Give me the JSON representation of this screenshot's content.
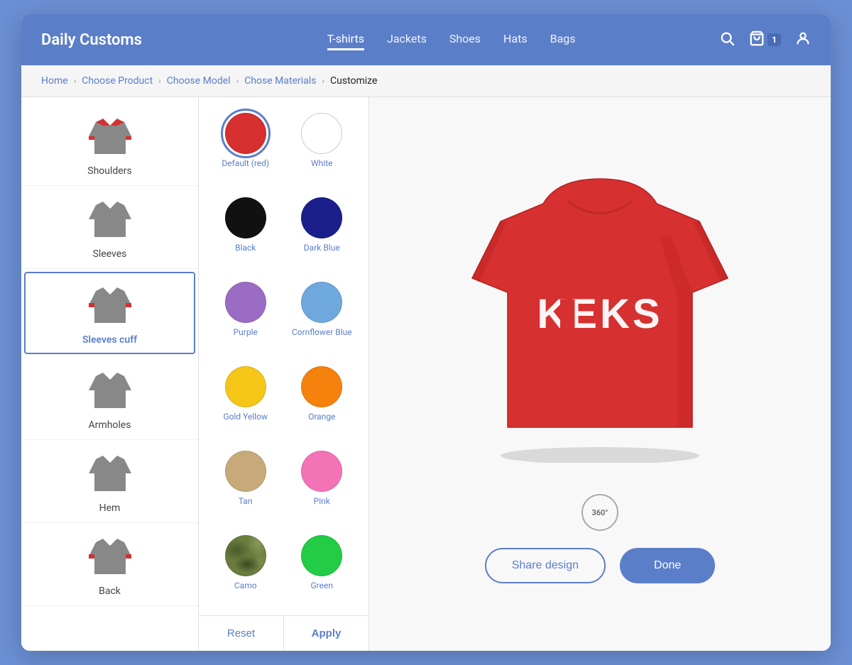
{
  "app": {
    "title": "Daily Customs",
    "star_icon": "⭐"
  },
  "header": {
    "nav": [
      {
        "label": "T-shirts",
        "active": true
      },
      {
        "label": "Jackets",
        "active": false
      },
      {
        "label": "Shoes",
        "active": false
      },
      {
        "label": "Hats",
        "active": false
      },
      {
        "label": "Bags",
        "active": false
      }
    ],
    "cart_count": "1"
  },
  "breadcrumb": {
    "items": [
      {
        "label": "Home",
        "active": false
      },
      {
        "label": "Choose Product",
        "active": false
      },
      {
        "label": "Choose Model",
        "active": false
      },
      {
        "label": "Chose Materials",
        "active": false
      },
      {
        "label": "Customize",
        "active": true
      }
    ]
  },
  "parts": [
    {
      "label": "Shoulders",
      "selected": false,
      "body_color": "#888",
      "accent_color": "#d63030"
    },
    {
      "label": "Sleeves",
      "selected": false,
      "body_color": "#888",
      "accent_color": "#888"
    },
    {
      "label": "Sleeves cuff",
      "selected": true,
      "body_color": "#888",
      "accent_color": "#d63030"
    },
    {
      "label": "Armholes",
      "selected": false,
      "body_color": "#888",
      "accent_color": "#888"
    },
    {
      "label": "Hem",
      "selected": false,
      "body_color": "#888",
      "accent_color": "#888"
    },
    {
      "label": "Back",
      "selected": false,
      "body_color": "#888",
      "accent_color": "#d63030"
    }
  ],
  "colors": [
    {
      "label": "Default (red)",
      "value": "#d63030",
      "selected": true
    },
    {
      "label": "White",
      "value": "#ffffff",
      "border": true
    },
    {
      "label": "Black",
      "value": "#111111"
    },
    {
      "label": "Dark Blue",
      "value": "#1a1f8c"
    },
    {
      "label": "Purple",
      "value": "#9b6cc4"
    },
    {
      "label": "Cornflower Blue",
      "value": "#6fa8dc"
    },
    {
      "label": "Gold Yellow",
      "value": "#f5c518"
    },
    {
      "label": "Orange",
      "value": "#f5820d"
    },
    {
      "label": "Tan",
      "value": "#c8a97a"
    },
    {
      "label": "Pink",
      "value": "#f472b6"
    },
    {
      "label": "Camo",
      "value": "camo"
    },
    {
      "label": "Green",
      "value": "#22cc44"
    }
  ],
  "actions": {
    "reset": "Reset",
    "apply": "Apply",
    "share_design": "Share design",
    "done": "Done"
  },
  "preview": {
    "shirt_color": "#d63030",
    "text": "KEKS",
    "rotate_label": "360°"
  }
}
